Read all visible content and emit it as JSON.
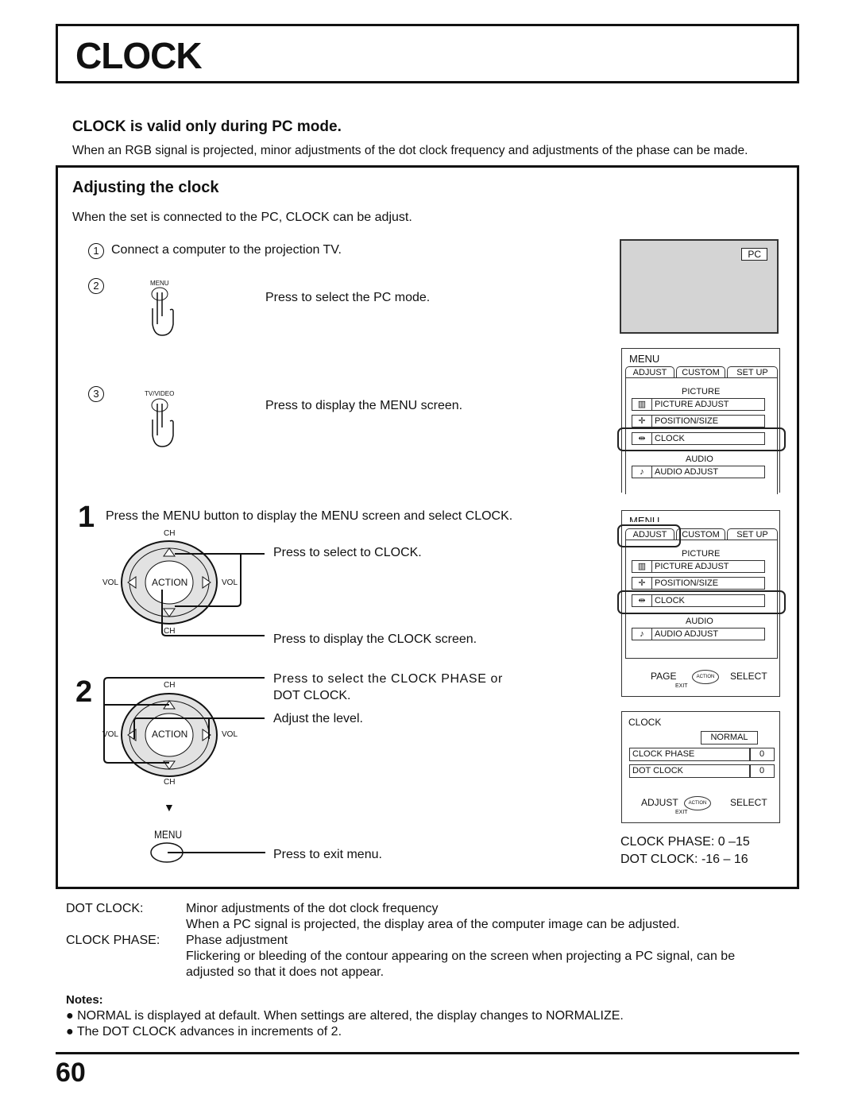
{
  "title": "CLOCK",
  "subtitle": "CLOCK is valid only during PC mode.",
  "intro": "When an RGB signal is projected, minor adjustments of the dot clock frequency and adjustments of the phase can be made.",
  "section": {
    "heading": "Adjusting the clock",
    "lead": "When the set is connected to the PC, CLOCK can be adjust.",
    "steps_prep": [
      {
        "num": "1",
        "text": "Connect a computer to the projection TV."
      },
      {
        "num": "2",
        "button": "MENU",
        "text": "Press to select the PC mode."
      },
      {
        "num": "3",
        "button": "TV/VIDEO",
        "text": "Press to display the MENU screen."
      }
    ],
    "step1": {
      "num": "1",
      "text": "Press the MENU button to display the MENU screen and select CLOCK.",
      "up_text": "Press to select to CLOCK.",
      "action_text": "Press to display the CLOCK  screen."
    },
    "step2": {
      "num": "2",
      "select_text_1": "Press to select the CLOCK PHASE or",
      "select_text_2": "DOT CLOCK.",
      "adjust_text": "Adjust the level.",
      "menu_button": "MENU",
      "exit_text": "Press to exit menu."
    },
    "remote": {
      "ch": "CH",
      "vol": "VOL",
      "action": "ACTION"
    },
    "pc_screen": {
      "badge": "PC"
    },
    "menu_osd": {
      "title": "MENU",
      "tabs": [
        "ADJUST",
        "CUSTOM",
        "SET  UP"
      ],
      "picture_header": "PICTURE",
      "items": [
        "PICTURE  ADJUST",
        "POSITION/SIZE",
        "CLOCK"
      ],
      "audio_header": "AUDIO",
      "audio_item": "AUDIO  ADJUST",
      "nav_left": "PAGE",
      "nav_right": "SELECT",
      "nav_center": "ACTION",
      "exit": "EXIT"
    },
    "clock_osd": {
      "title": "CLOCK",
      "mode": "NORMAL",
      "rows": [
        {
          "label": "CLOCK  PHASE",
          "value": "0"
        },
        {
          "label": "DOT  CLOCK",
          "value": "0"
        }
      ],
      "nav_left": "ADJUST",
      "nav_right": "SELECT",
      "nav_center": "ACTION",
      "exit": "EXIT"
    },
    "ranges": [
      "CLOCK PHASE: 0 –15",
      "DOT CLOCK: -16 – 16"
    ]
  },
  "definitions": [
    {
      "term": "DOT CLOCK:",
      "lines": [
        "Minor adjustments of the dot clock frequency",
        "When a PC signal is projected, the display area of the computer image can be adjusted."
      ]
    },
    {
      "term": "CLOCK PHASE:",
      "lines": [
        "Phase adjustment",
        "Flickering or bleeding of the contour appearing on the screen when projecting a PC signal, can be",
        "adjusted so that it does not appear."
      ]
    }
  ],
  "notes": {
    "heading": "Notes:",
    "items": [
      "NORMAL is displayed at default. When settings are altered, the display changes to NORMALIZE.",
      "The DOT CLOCK advances in increments of 2."
    ]
  },
  "page_number": "60"
}
